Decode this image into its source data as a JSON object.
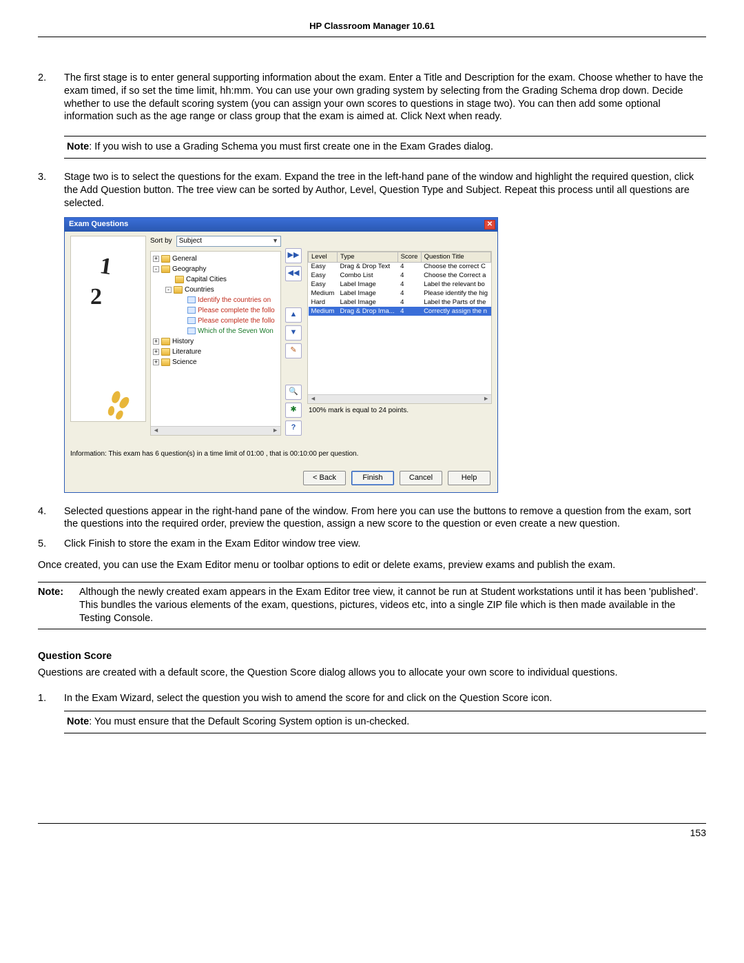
{
  "header": "HP Classroom Manager 10.61",
  "page_number": "153",
  "steps_a": {
    "2": "The first stage is to enter general supporting information about the exam. Enter a Title and Description for the exam. Choose whether to have the exam timed, if so set the time limit, hh:mm. You can use your own grading system by selecting from the Grading Schema drop down. Decide whether to use the default scoring system (you can assign your own scores to questions in stage two). You can then add some optional information such as the age range or class group that the exam is aimed at. Click Next when ready.",
    "3": "Stage two is to select the questions for the exam. Expand the tree in the left-hand pane of the window and highlight the required question, click the Add Question button. The tree view can be sorted by Author, Level, Question Type and Subject. Repeat this process until all questions are selected."
  },
  "note1_label": "Note",
  "note1_text": ": If you wish to use a Grading Schema you must first create one in the Exam Grades dialog.",
  "steps_b": {
    "4": "Selected questions appear in the right-hand pane of the window. From here you can use the buttons to remove a question from the exam, sort the questions into the required order, preview the question, assign a new score to the question or even create a new question.",
    "5": "Click Finish to store the exam in the Exam Editor window tree view."
  },
  "followup": "Once created, you can use the Exam Editor menu or toolbar options to edit or delete exams, preview exams and publish the exam.",
  "note2_label": "Note:",
  "note2_text": "Although the newly created exam appears in the Exam Editor tree view, it cannot be run at Student workstations until it has been 'published'. This bundles the various elements of the exam, questions, pictures, videos etc, into a single ZIP file which is then made available in the Testing Console.",
  "qs_heading": "Question Score",
  "qs_para": "Questions are created with a default score, the Question Score dialog allows you to allocate your own score to individual questions.",
  "qs_step1": "In the Exam Wizard, select the question you wish to amend the score for and click on the Question Score icon.",
  "qs_note_label": "Note",
  "qs_note_text": ": You must ensure that the Default Scoring System option is un-checked.",
  "dialog": {
    "title": "Exam Questions",
    "sortby_label": "Sort by",
    "sortby_value": "Subject",
    "tree": {
      "root": [
        {
          "k": "general",
          "label": "General",
          "exp": "+"
        },
        {
          "k": "geo",
          "label": "Geography",
          "exp": "-"
        },
        {
          "k": "history",
          "label": "History",
          "exp": "+"
        },
        {
          "k": "lit",
          "label": "Literature",
          "exp": "+"
        },
        {
          "k": "science",
          "label": "Science",
          "exp": "+"
        }
      ],
      "geo_children": [
        {
          "label": "Capital Cities",
          "type": "folder"
        },
        {
          "label": "Countries",
          "type": "folder",
          "exp": "-"
        }
      ],
      "countries_children": [
        {
          "label": "Identify the countries on",
          "cls": "tred"
        },
        {
          "label": "Please complete the follo",
          "cls": "tred"
        },
        {
          "label": "Please complete the follo",
          "cls": "tred"
        },
        {
          "label": "Which of the Seven Won",
          "cls": "tgreen"
        }
      ]
    },
    "buttons": {
      "add": "▶▶",
      "remove": "◀◀",
      "up": "▲",
      "down": "▼",
      "edit": "✎",
      "zoom": "🔍",
      "score": "✱",
      "help": "?"
    },
    "table": {
      "headers": {
        "level": "Level",
        "type": "Type",
        "score": "Score",
        "title": "Question Title"
      },
      "rows": [
        {
          "level": "Easy",
          "type": "Drag & Drop Text",
          "score": "4",
          "title": "Choose the correct C"
        },
        {
          "level": "Easy",
          "type": "Combo List",
          "score": "4",
          "title": "Choose the Correct a"
        },
        {
          "level": "Easy",
          "type": "Label Image",
          "score": "4",
          "title": "Label the relevant bo"
        },
        {
          "level": "Medium",
          "type": "Label Image",
          "score": "4",
          "title": "Please identify the hig"
        },
        {
          "level": "Hard",
          "type": "Label Image",
          "score": "4",
          "title": "Label the Parts of the"
        },
        {
          "level": "Medium",
          "type": "Drag & Drop Ima...",
          "score": "4",
          "title": "Correctly assign the n",
          "sel": true
        }
      ]
    },
    "status": "100% mark is equal to 24 points.",
    "info": "Information: This exam has 6 question(s) in a time limit of 01:00 , that is 00:10:00 per question.",
    "actions": {
      "back": "< Back",
      "finish": "Finish",
      "cancel": "Cancel",
      "help": "Help"
    }
  }
}
